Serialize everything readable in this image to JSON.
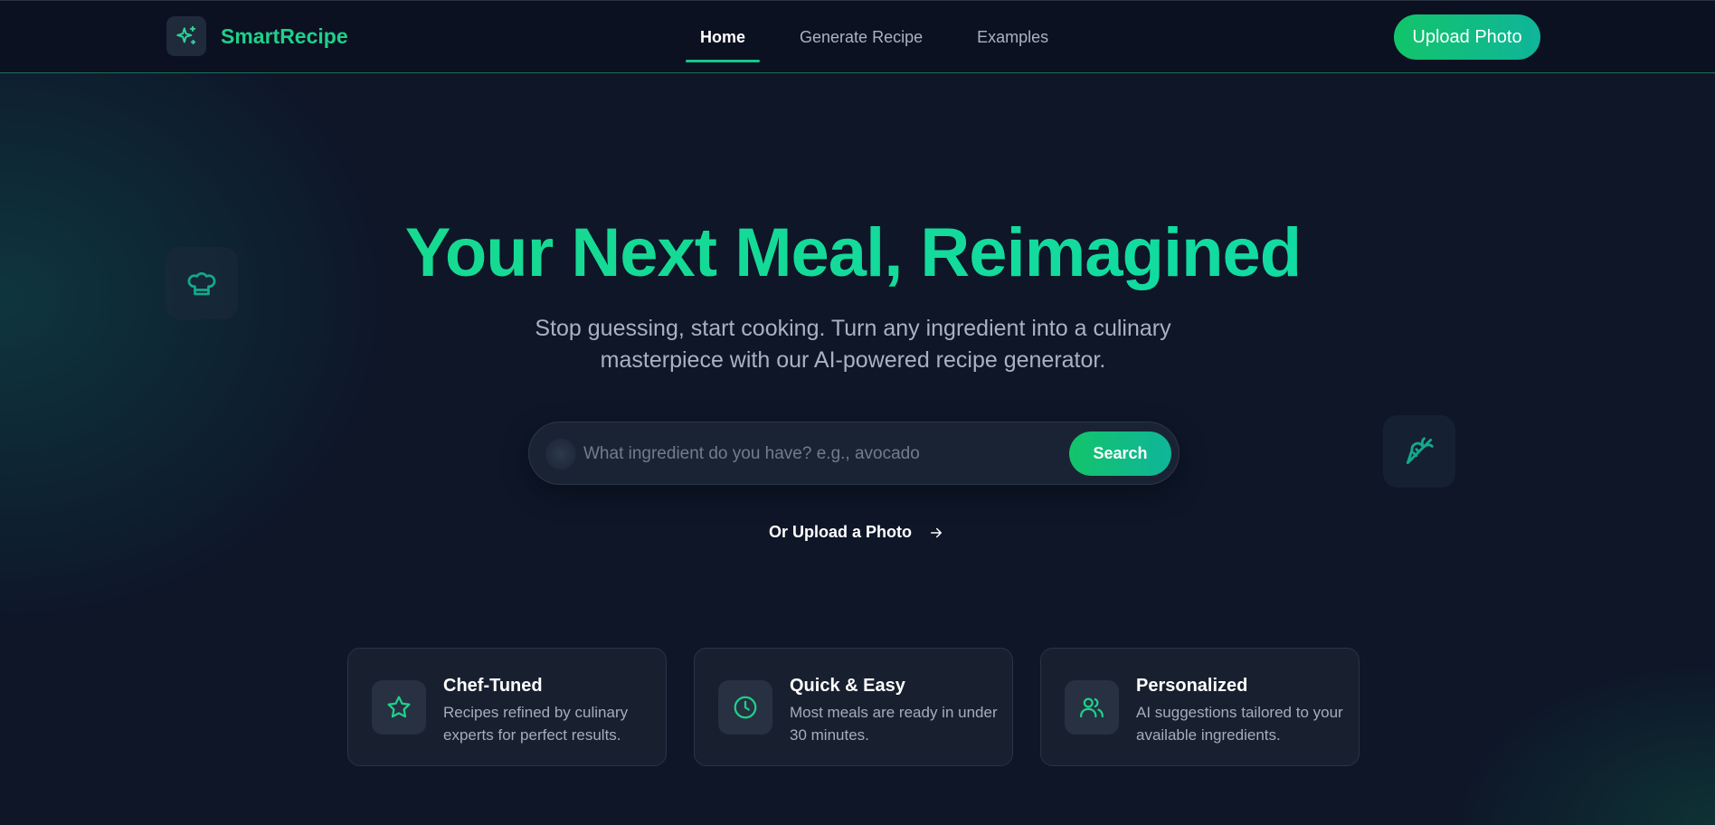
{
  "brand": {
    "name": "SmartRecipe",
    "icon": "sparkles-icon",
    "accent": "#12c98a"
  },
  "nav": {
    "items": [
      {
        "label": "Home",
        "active": true
      },
      {
        "label": "Generate Recipe",
        "active": false
      },
      {
        "label": "Examples",
        "active": false
      }
    ],
    "upload_label": "Upload Photo"
  },
  "hero": {
    "title": "Your Next Meal, Reimagined",
    "subtitle": "Stop guessing, start cooking. Turn any ingredient into a culinary masterpiece with our AI-powered recipe generator.",
    "left_float_icon": "chef-hat-icon",
    "right_float_icon": "carrot-icon"
  },
  "search": {
    "placeholder": "What ingredient do you have? e.g., avocado",
    "value": "",
    "button_label": "Search"
  },
  "upload_link": {
    "label": "Or Upload a Photo",
    "icon": "arrow-right-icon"
  },
  "features": [
    {
      "title": "Chef-Tuned",
      "description": "Recipes refined by culinary experts for perfect results.",
      "icon": "star-icon"
    },
    {
      "title": "Quick & Easy",
      "description": "Most meals are ready in under 30 minutes.",
      "icon": "clock-icon"
    },
    {
      "title": "Personalized",
      "description": "AI suggestions tailored to your available ingredients.",
      "icon": "users-icon"
    }
  ]
}
